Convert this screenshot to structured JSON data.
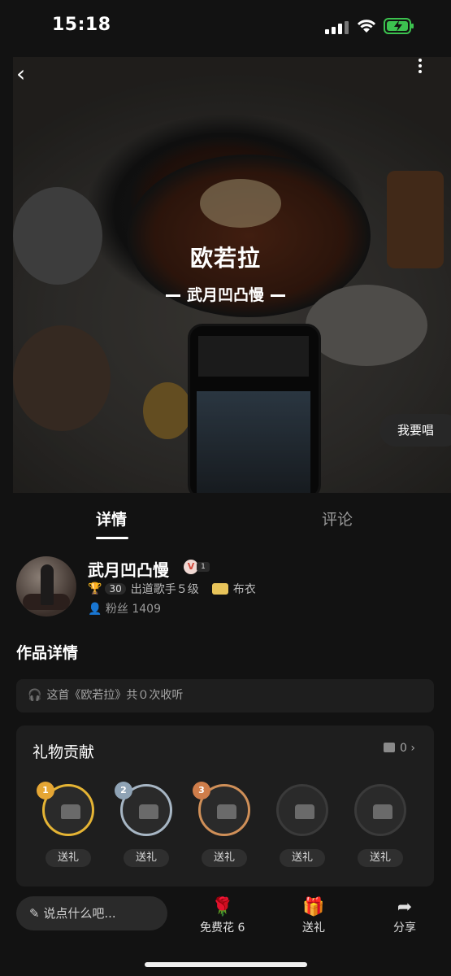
{
  "status": {
    "time": "15:18"
  },
  "cover": {
    "title": "欧若拉",
    "artist": "武月凹凸慢",
    "sing_button": "我要唱"
  },
  "tabs": [
    {
      "label": "详情"
    },
    {
      "label": "评论"
    }
  ],
  "user": {
    "name": "武月凹凸慢",
    "vip_level": "1",
    "cups": "30",
    "level_text": "出道歌手５级",
    "title_badge": "布衣",
    "fans_label": "粉丝",
    "fans": "1409"
  },
  "work_section_title": "作品详情",
  "listen_text": "这首《欧若拉》共０次收听",
  "gifts": {
    "title": "礼物贡献",
    "count": "0",
    "slots": [
      {
        "rank": "1",
        "button": "送礼",
        "ring": "#e5b434"
      },
      {
        "rank": "2",
        "button": "送礼",
        "ring": "#a7b6c4"
      },
      {
        "rank": "3",
        "button": "送礼",
        "ring": "#cf8f58"
      },
      {
        "rank": "",
        "button": "送礼",
        "ring": "#3a3a3a"
      },
      {
        "rank": "",
        "button": "送礼",
        "ring": "#3a3a3a"
      }
    ]
  },
  "bottom": {
    "comment_placeholder": "说点什么吧...",
    "flower_label": "免费花",
    "flower_count": "6",
    "gift_label": "送礼",
    "share_label": "分享"
  }
}
